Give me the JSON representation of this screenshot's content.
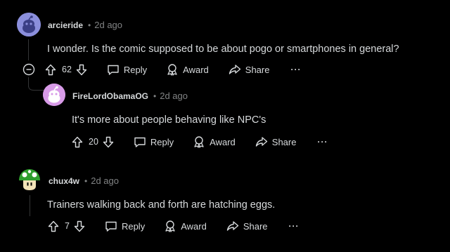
{
  "comments": [
    {
      "username": "arcieride",
      "separator": "•",
      "time": "2d ago",
      "text": "I wonder. Is the comic supposed to be about pogo or smartphones in general?",
      "votes": "62",
      "actions": {
        "reply": "Reply",
        "award": "Award",
        "share": "Share",
        "more": "···"
      },
      "avatar": {
        "icon": "reddit-snoo-avatar",
        "bg": "#8b8fdc"
      }
    },
    {
      "username": "FireLordObamaOG",
      "separator": "•",
      "time": "2d ago",
      "text": "It's more about people behaving like NPC's",
      "votes": "20",
      "actions": {
        "reply": "Reply",
        "award": "Award",
        "share": "Share",
        "more": "···"
      },
      "avatar": {
        "icon": "reddit-snoo-avatar",
        "bg": "#d89be8"
      }
    },
    {
      "username": "chux4w",
      "separator": "•",
      "time": "2d ago",
      "text": "Trainers walking back and forth are hatching eggs.",
      "votes": "7",
      "actions": {
        "reply": "Reply",
        "award": "Award",
        "share": "Share",
        "more": "···"
      },
      "avatar": {
        "icon": "green-mushroom-avatar",
        "bg": "#2e8b2e"
      }
    }
  ],
  "colors": {
    "background": "#000000",
    "text": "#d7dadc",
    "muted": "#818384",
    "thread_line": "#343536"
  },
  "icons": [
    "collapse-minus-icon",
    "upvote-icon",
    "downvote-icon",
    "reply-bubble-icon",
    "award-icon",
    "share-arrow-icon"
  ]
}
